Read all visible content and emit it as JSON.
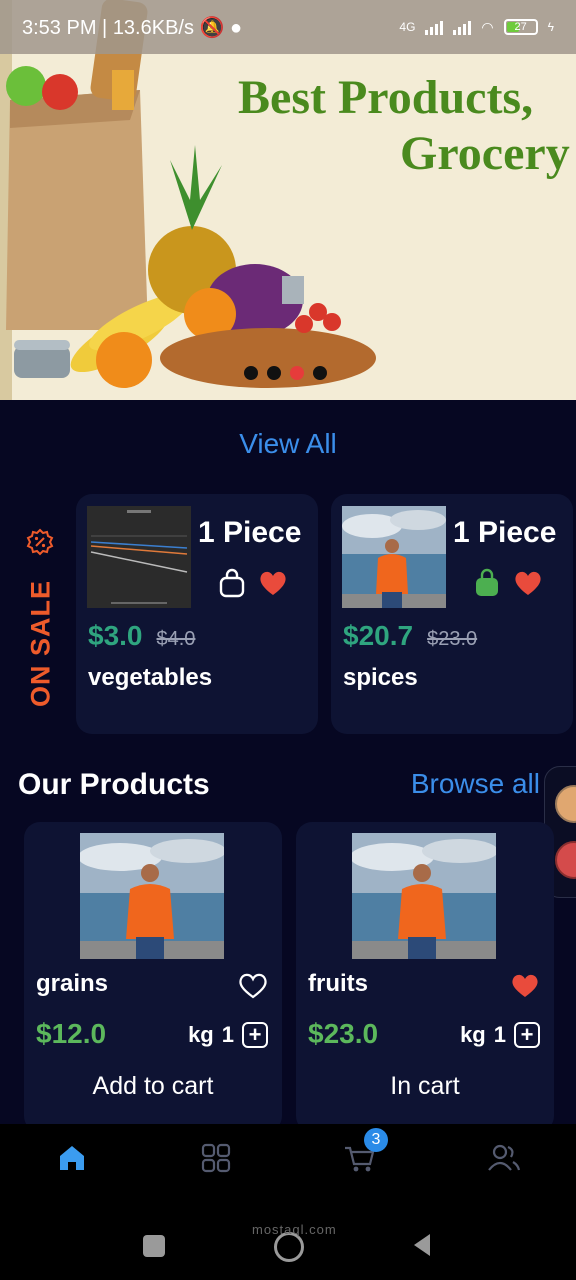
{
  "status_bar": {
    "time": "3:53 PM",
    "separator": "|",
    "speed": "13.6KB/s",
    "network": "4G",
    "battery": "27",
    "icons": [
      "muted-alarm-icon",
      "notification-icon",
      "signal-icon",
      "wifi-icon",
      "battery-icon",
      "charging-icon"
    ]
  },
  "banner": {
    "title_line1": "Best Products,",
    "title_line2": "Grocery",
    "slides": 4,
    "active_slide": 3
  },
  "view_all": "View All",
  "on_sale": {
    "label": "ON SALE",
    "icon": "sale-badge-icon",
    "items": [
      {
        "quantity": "1 Piece",
        "price": "$3.0",
        "old_price": "$4.0",
        "name": "vegetables",
        "in_bag": false,
        "favorite": true
      },
      {
        "quantity": "1 Piece",
        "price": "$20.7",
        "old_price": "$23.0",
        "name": "spices",
        "in_bag": true,
        "favorite": true
      }
    ]
  },
  "our_products": {
    "title": "Our Products",
    "browse_all": "Browse all",
    "items": [
      {
        "name": "grains",
        "price": "$12.0",
        "unit": "kg",
        "quantity": "1",
        "action": "Add to cart",
        "favorite": false
      },
      {
        "name": "fruits",
        "price": "$23.0",
        "unit": "kg",
        "quantity": "1",
        "action": "In cart",
        "favorite": true
      }
    ]
  },
  "bottom_nav": {
    "items": [
      "home-icon",
      "categories-icon",
      "cart-icon",
      "profile-icon"
    ],
    "cart_count": "3"
  },
  "watermark": "mostaql.com",
  "colors": {
    "background": "#060722",
    "card": "#0e1333",
    "accent": "#3b8eea",
    "sale": "#ee5b2b",
    "sale_price": "#2fa57f",
    "price": "#5cb85c",
    "favorite": "#e94b3c",
    "bag_active": "#4caf50"
  }
}
